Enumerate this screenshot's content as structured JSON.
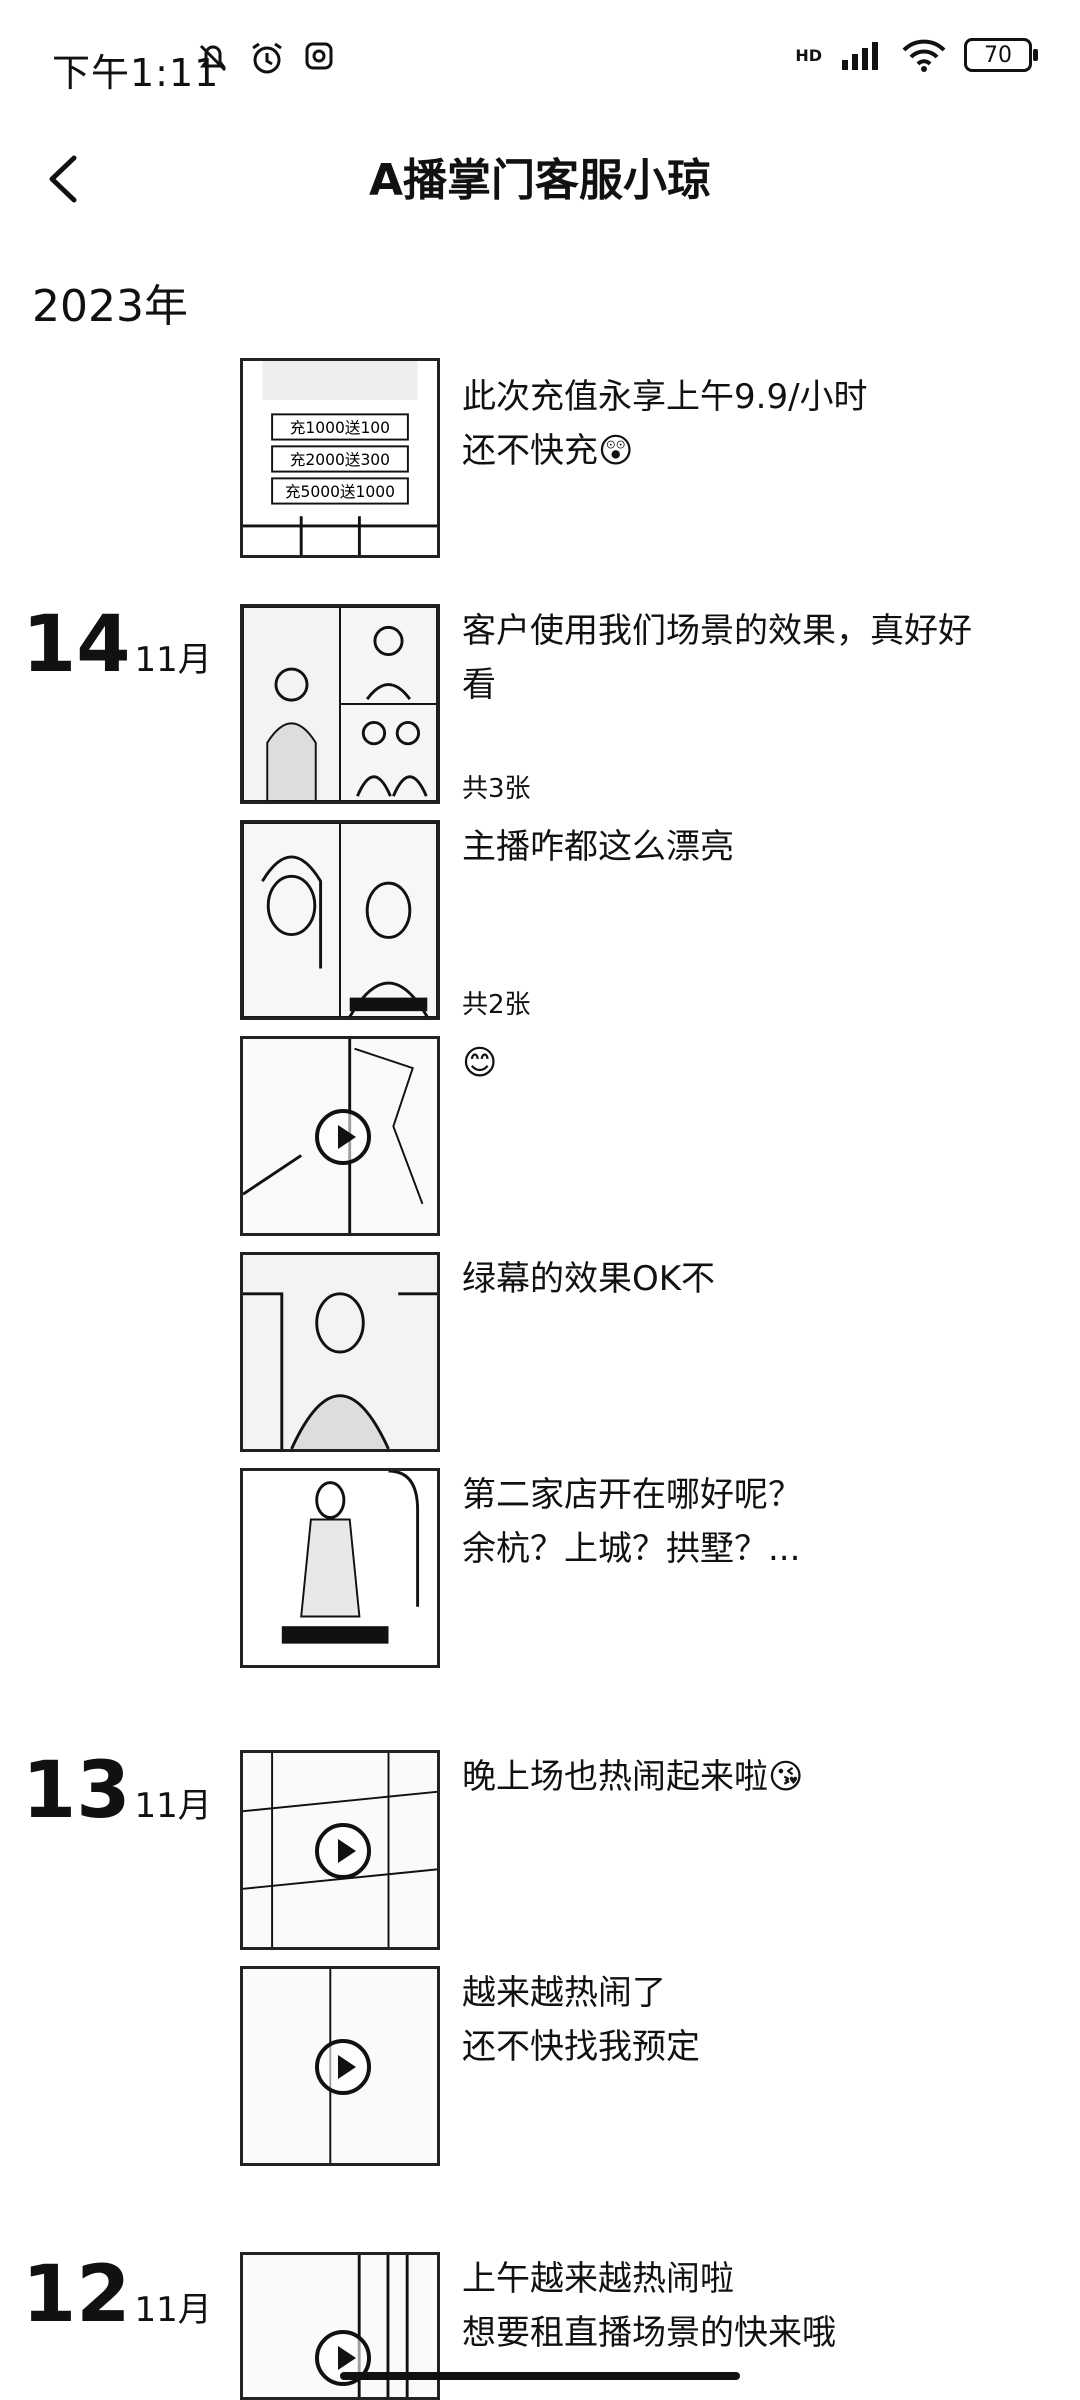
{
  "status_bar": {
    "time": "下午1:11",
    "network": "HD",
    "battery": "70"
  },
  "header": {
    "title": "A播掌门客服小琼"
  },
  "year": "2023年",
  "groups": [
    {
      "day": "",
      "month": "",
      "posts": [
        {
          "caption_lines": [
            "此次充值永享上午9.9/小时",
            "还不快充😲"
          ],
          "thumb_text": [
            "充1000送100",
            "充2000送300",
            "充5000送1000"
          ]
        }
      ]
    },
    {
      "day": "14",
      "month": "11月",
      "posts": [
        {
          "caption_lines": [
            "客户使用我们场景的效果，真好好",
            "看"
          ],
          "count": "共3张"
        },
        {
          "caption_lines": [
            "主播咋都这么漂亮"
          ],
          "count": "共2张"
        },
        {
          "caption_lines": [
            "😊"
          ],
          "video": true
        },
        {
          "caption_lines": [
            "绿幕的效果OK不"
          ]
        },
        {
          "caption_lines": [
            "第二家店开在哪好呢？",
            "余杭？上城？拱墅？..."
          ]
        }
      ]
    },
    {
      "day": "13",
      "month": "11月",
      "posts": [
        {
          "caption_lines": [
            "晚上场也热闹起来啦😘"
          ],
          "video": true
        },
        {
          "caption_lines": [
            "越来越热闹了",
            "还不快找我预定"
          ],
          "video": true
        }
      ]
    },
    {
      "day": "12",
      "month": "11月",
      "posts": [
        {
          "caption_lines": [
            "上午越来越热闹啦",
            "想要租直播场景的快来哦"
          ],
          "video": true
        }
      ]
    }
  ]
}
